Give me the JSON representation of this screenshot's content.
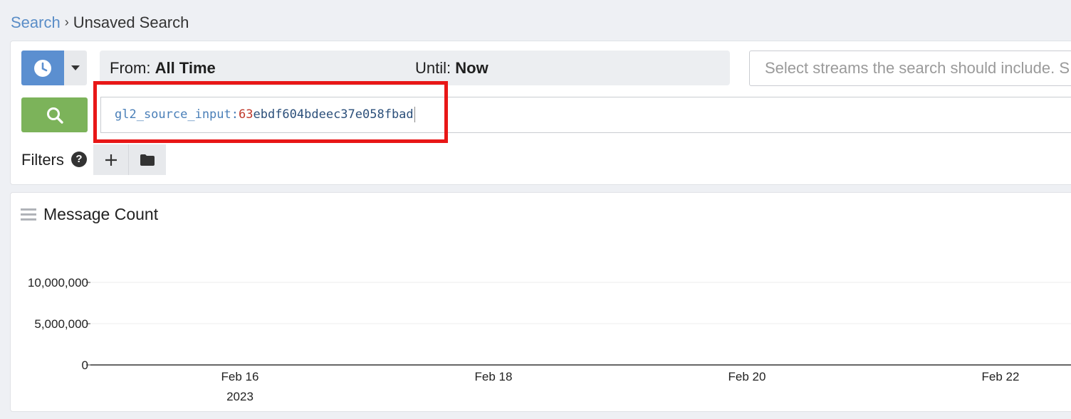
{
  "breadcrumb": {
    "parent": "Search",
    "separator": "›",
    "current": "Unsaved Search"
  },
  "time_range": {
    "from_label": "From:",
    "from_value": "All Time",
    "until_label": "Until:",
    "until_value": "Now"
  },
  "streams": {
    "placeholder": "Select streams the search should include. S"
  },
  "query": {
    "key": "gl2_source_input:",
    "value_highlight": "63",
    "value_rest": "ebdf604bdeec37e058fbad"
  },
  "filters": {
    "label": "Filters",
    "help": "?"
  },
  "icons": {
    "time": "clock-icon",
    "caret": "caret-down-icon",
    "search": "search-icon",
    "add": "plus-icon",
    "folder": "folder-icon",
    "drag": "drag-handle-icon"
  },
  "colors": {
    "time_button": "#5b8fd0",
    "search_button": "#7cb35a",
    "highlight": "#e81717",
    "link": "#5a8dc7"
  },
  "widget": {
    "title": "Message Count"
  },
  "chart_data": {
    "type": "bar",
    "title": "Message Count",
    "y_ticks": [
      "10,000,000",
      "5,000,000",
      "0"
    ],
    "y_tick_values": [
      10000000,
      5000000,
      0
    ],
    "x_ticks": [
      {
        "label": "Feb 16",
        "sub": "2023"
      },
      {
        "label": "Feb 18",
        "sub": ""
      },
      {
        "label": "Feb 20",
        "sub": ""
      },
      {
        "label": "Feb 22",
        "sub": ""
      }
    ],
    "ylim": [
      0,
      10000000
    ],
    "values": [],
    "grid": true
  }
}
